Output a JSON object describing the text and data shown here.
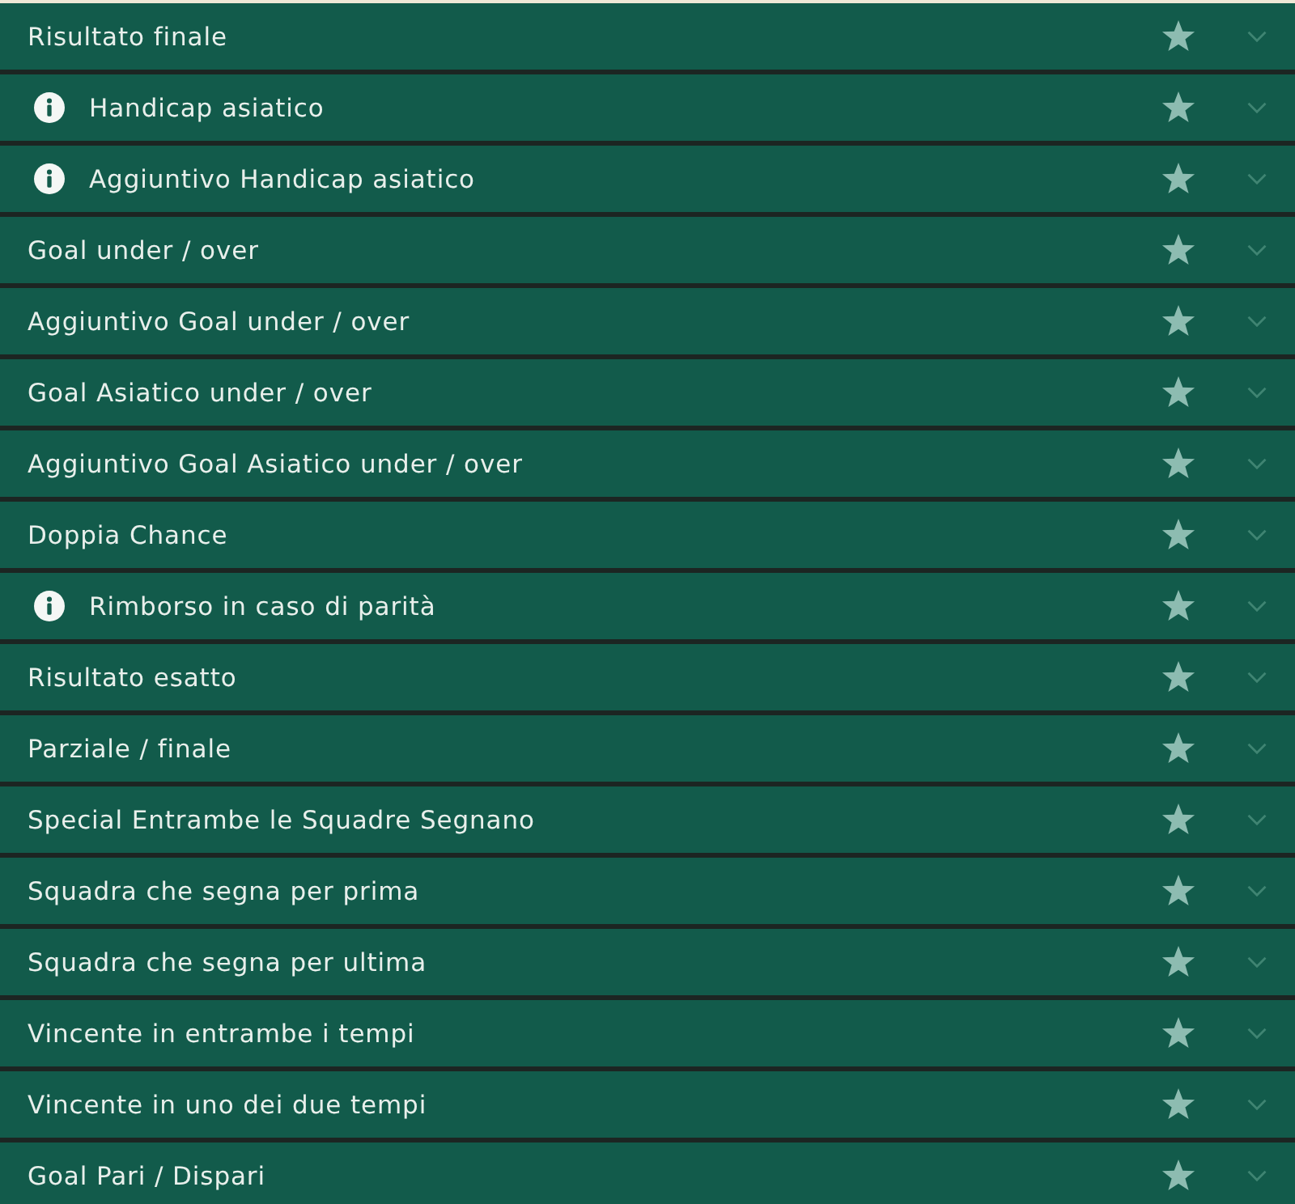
{
  "markets": [
    {
      "label": "Risultato finale",
      "info": false
    },
    {
      "label": "Handicap asiatico",
      "info": true
    },
    {
      "label": "Aggiuntivo Handicap asiatico",
      "info": true
    },
    {
      "label": "Goal under / over",
      "info": false
    },
    {
      "label": "Aggiuntivo Goal under / over",
      "info": false
    },
    {
      "label": "Goal Asiatico under / over",
      "info": false
    },
    {
      "label": "Aggiuntivo Goal Asiatico under / over",
      "info": false
    },
    {
      "label": "Doppia Chance",
      "info": false
    },
    {
      "label": "Rimborso in caso di parità",
      "info": true
    },
    {
      "label": "Risultato esatto",
      "info": false
    },
    {
      "label": "Parziale / finale",
      "info": false
    },
    {
      "label": "Special Entrambe le Squadre Segnano",
      "info": false
    },
    {
      "label": "Squadra che segna per prima",
      "info": false
    },
    {
      "label": "Squadra che segna per ultima",
      "info": false
    },
    {
      "label": "Vincente in entrambe i tempi",
      "info": false
    },
    {
      "label": "Vincente in uno dei due tempi",
      "info": false
    },
    {
      "label": "Goal Pari / Dispari",
      "info": false
    }
  ]
}
